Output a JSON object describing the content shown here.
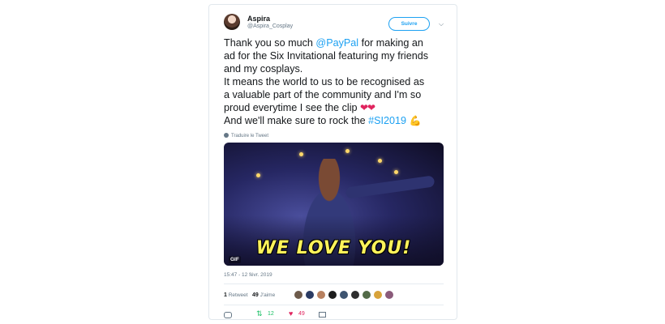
{
  "author": {
    "name": "Aspira",
    "handle": "@Aspira_Cosplay"
  },
  "header": {
    "follow_label": "Suivre",
    "menu_icon": "chevron-down-icon"
  },
  "tweet": {
    "line1_pre": "Thank you so much ",
    "mention": "@PayPal",
    "line1_post": " for making an",
    "line2": "ad for the Six Invitational featuring my friends",
    "line3": "and my cosplays.",
    "line4": "It means the world to us to be recognised as",
    "line5": "a valuable part of the community and I'm so",
    "line6": "proud everytime I see the clip ",
    "hearts": "❤❤",
    "line7_pre": "And we'll make sure to rock the ",
    "hashtag": "#SI2019",
    "muscle_emoji": "💪"
  },
  "translate_label": "Traduire le Tweet",
  "media": {
    "caption": "WE LOVE YOU!",
    "badge": "GIF"
  },
  "timestamp": "15:47 - 12 févr. 2019",
  "stats": {
    "retweets_count": "1",
    "retweets_label": "Retweet",
    "likes_count": "49",
    "likes_label": "J'aime"
  },
  "actions": {
    "retweet_count": "12",
    "like_count": "49"
  },
  "colors": {
    "accent": "#1da1f2",
    "retweet": "#17bf63",
    "like": "#e0245e",
    "muted": "#657786"
  }
}
